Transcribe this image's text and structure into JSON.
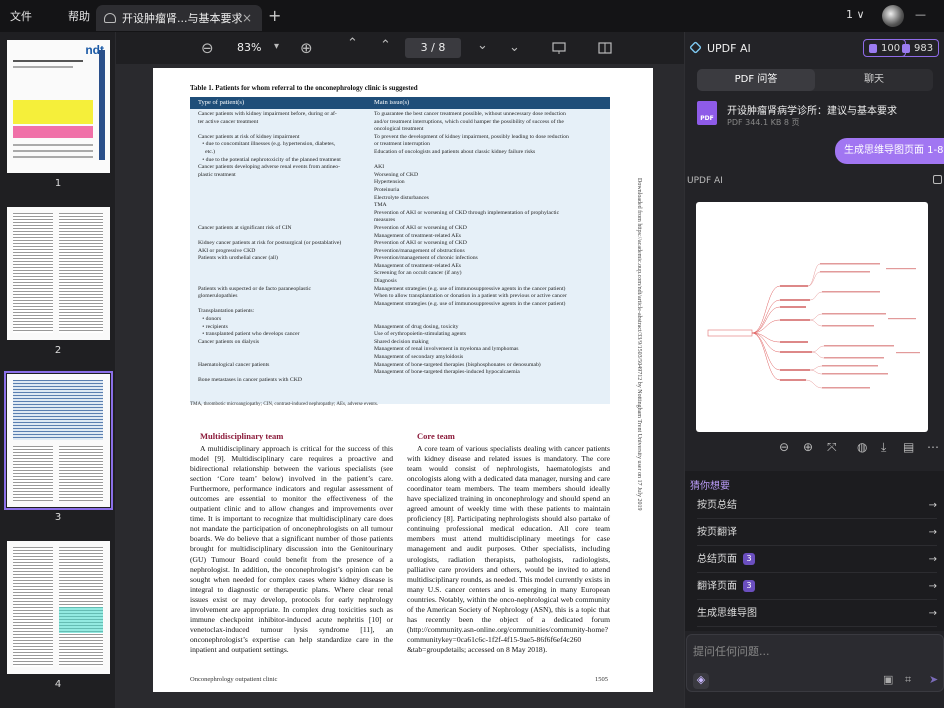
{
  "titlebar": {
    "menu_file": "文件",
    "menu_help": "帮助",
    "tab_title": "开设肿瘤肾...与基本要求",
    "tab_close": "×",
    "new_tab": "+",
    "version": "1 ∨",
    "win_min": "—"
  },
  "toolbar": {
    "zoom": "83%",
    "page": "3 / 8",
    "zoom_out": "⊖",
    "zoom_in": "⊕",
    "dropdown": "▾",
    "first": "⌃",
    "prev": "⌃",
    "next": "⌄",
    "last": "⌄"
  },
  "thumbs": [
    "1",
    "2",
    "3",
    "4"
  ],
  "page": {
    "table_caption": "Table 1. Patients for whom referral to the onconephrology clinic is suggested",
    "col1": "Type of patient(s)",
    "col2": "Main issue(s)",
    "left_rows": [
      "Cancer patients with kidney impairment before, during or af-",
      "ter active cancer treatment",
      "",
      "Cancer patients at risk of kidney impairment",
      "   • due to concomitant illnesses (e.g. hypertension, diabetes,",
      "     etc.)",
      "   • due to the potential nephrotoxicity of the planned treatment",
      "Cancer patients developing adverse renal events from antineo-",
      "plastic treatment",
      "",
      "",
      "",
      "",
      "",
      "",
      "Cancer patients at significant risk of CIN",
      "",
      "Kidney cancer patients at risk for postsurgical (or postablative)",
      "AKI or progressive CKD",
      "Patients with urothelial cancer (all)",
      "",
      "",
      "",
      "Patients with suspected or de facto paraneoplastic",
      "glomerulopathies",
      "",
      "Transplantation patients:",
      "   • donors",
      "   • recipients",
      "   • transplanted patient who develops cancer",
      "Cancer patients on dialysis",
      "",
      "",
      "Haematological cancer patients",
      "",
      "Bone metastases in cancer patients with CKD"
    ],
    "right_rows": [
      "To guarantee the best cancer treatment possible, without unnecessary dose reduction",
      "and/or treatment interruptions, which could hamper the possibility of success of the",
      "oncological treatment",
      "To prevent the development of kidney impairment, possibly leading to dose reduction",
      "or treatment interruption",
      "Education of oncologists and patients about classic kidney failure risks",
      "",
      "AKI",
      "Worsening of CKD",
      "Hypertension",
      "Proteinuria",
      "Electrolyte disturbances",
      "TMA",
      "Prevention of AKI or worsening of CKD through implementation of prophylactic",
      "measures",
      "Prevention of AKI or worsening of CKD",
      "Management of treatment-related AEs",
      "Prevention of AKI or worsening of CKD",
      "Prevention/management of obstructions",
      "Prevention/management of chronic infections",
      "Management of treatment-related AEs",
      "Screening for an occult cancer (if any)",
      "Diagnosis",
      "Management strategies (e.g. use of immunosuppressive agents in the cancer patient)",
      "When to allow transplantation or donation in a patient with previous or active cancer",
      "Management strategies (e.g. use of immunosuppressive agents in the cancer patient)",
      "",
      "",
      "Management of drug dosing, toxicity",
      "Use of erythropoietin-stimulating agents",
      "Shared decision making",
      "Management of renal involvement in myeloma and lymphomas",
      "Management of secondary amyloidosis",
      "Management of bone-targeted therapies (bisphosphonates or denosumab)",
      "Management of bone-targeted therapies-induced hypocalcaemia"
    ],
    "table_footnote": "TMA, thrombotic microangiopathy; CIN, contrast-induced nephropathy; AEs, adverse events.",
    "sec1": "Multidisciplinary team",
    "sec2": "Core team",
    "body1": "A multidisciplinary approach is critical for the success of this model [9]. Multidisciplinary care requires a proactive and bidirectional relationship between the various specialists (see section ‘Core team’ below) involved in the patient’s care. Furthermore, performance indicators and regular assessment of outcomes are essential to monitor the effectiveness of the outpatient clinic and to allow changes and improvements over time. It is important to recognize that multidisciplinary care does not mandate the participation of onconephrologists on all tumour boards. We do believe that a significant number of those patients brought for multidisciplinary discussion into the Genitourinary (GU) Tumour Board could benefit from the presence of a nephrologist. In addition, the onconephrologist’s opinion can be sought when needed for complex cases where kidney disease is integral to diagnostic or therapeutic plans. Where clear renal issues exist or may develop, protocols for early nephrology involvement are appropriate. In complex drug toxicities such as immune checkpoint inhibitor-induced acute nephritis [10] or venetoclax-induced tumour lysis syndrome [11], an onconephrologist’s expertise can help standardize care in the inpatient and outpatient settings.",
    "body2": "A core team of various specialists dealing with cancer patients with kidney disease and related issues is mandatory. The core team would consist of nephrologists, haematologists and oncologists along with a dedicated data manager, nursing and care coordinator team members. The team members should ideally have specialized training in onconephrology and should spend an agreed amount of weekly time with these patients to maintain proficiency [8]. Participating nephrologists should also partake of continuing professional medical education. All core team members must attend multidisciplinary meetings for case management and audit purposes. Other specialists, including urologists, radiation therapists, pathologists, radiologists, palliative care providers and others, would be invited to attend multidisciplinary rounds, as needed. This model currently exists in many U.S. cancer centers and is emerging in many European countries. Notably, within the onco-nephrological web community of the American Society of Nephrology (ASN), this is a topic that has recently been the object of a dedicated forum (http://community.asn-online.org/communities/community-home?communitykey=0ca61c6c-1f2f-4f15-9ae5-86f6f6ef4c260 &tab=groupdetails; accessed on 8 May 2018).",
    "footer_left": "Onconephrology outpatient clinic",
    "footer_right": "1505",
    "side_note": "Downloaded from https://academic.oup.com/ndt/article-abstract/33/9/1503/5049712 by Nottingham Trent University user on 17 July 2019"
  },
  "panel": {
    "title": "UPDF AI",
    "credit1": "100",
    "credit2": "983",
    "tab_pdf": "PDF 问答",
    "tab_chat": "聊天",
    "file_name": "开设肿瘤肾病学诊所：建议与基本要求",
    "file_meta": "PDF  344.1 KB  8 页",
    "pdf_label": "PDF",
    "bubble": "生成思维导图页面 1-8",
    "ai_label": "UPDF AI",
    "suggest_title": "猜你想要",
    "suggestions": [
      {
        "label": "按页总结",
        "badge": ""
      },
      {
        "label": "按页翻译",
        "badge": ""
      },
      {
        "label": "总结页面",
        "badge": "3"
      },
      {
        "label": "翻译页面",
        "badge": "3"
      },
      {
        "label": "生成思维导图",
        "badge": ""
      }
    ],
    "arrow": "→",
    "input_placeholder": "提问任何问题..."
  }
}
